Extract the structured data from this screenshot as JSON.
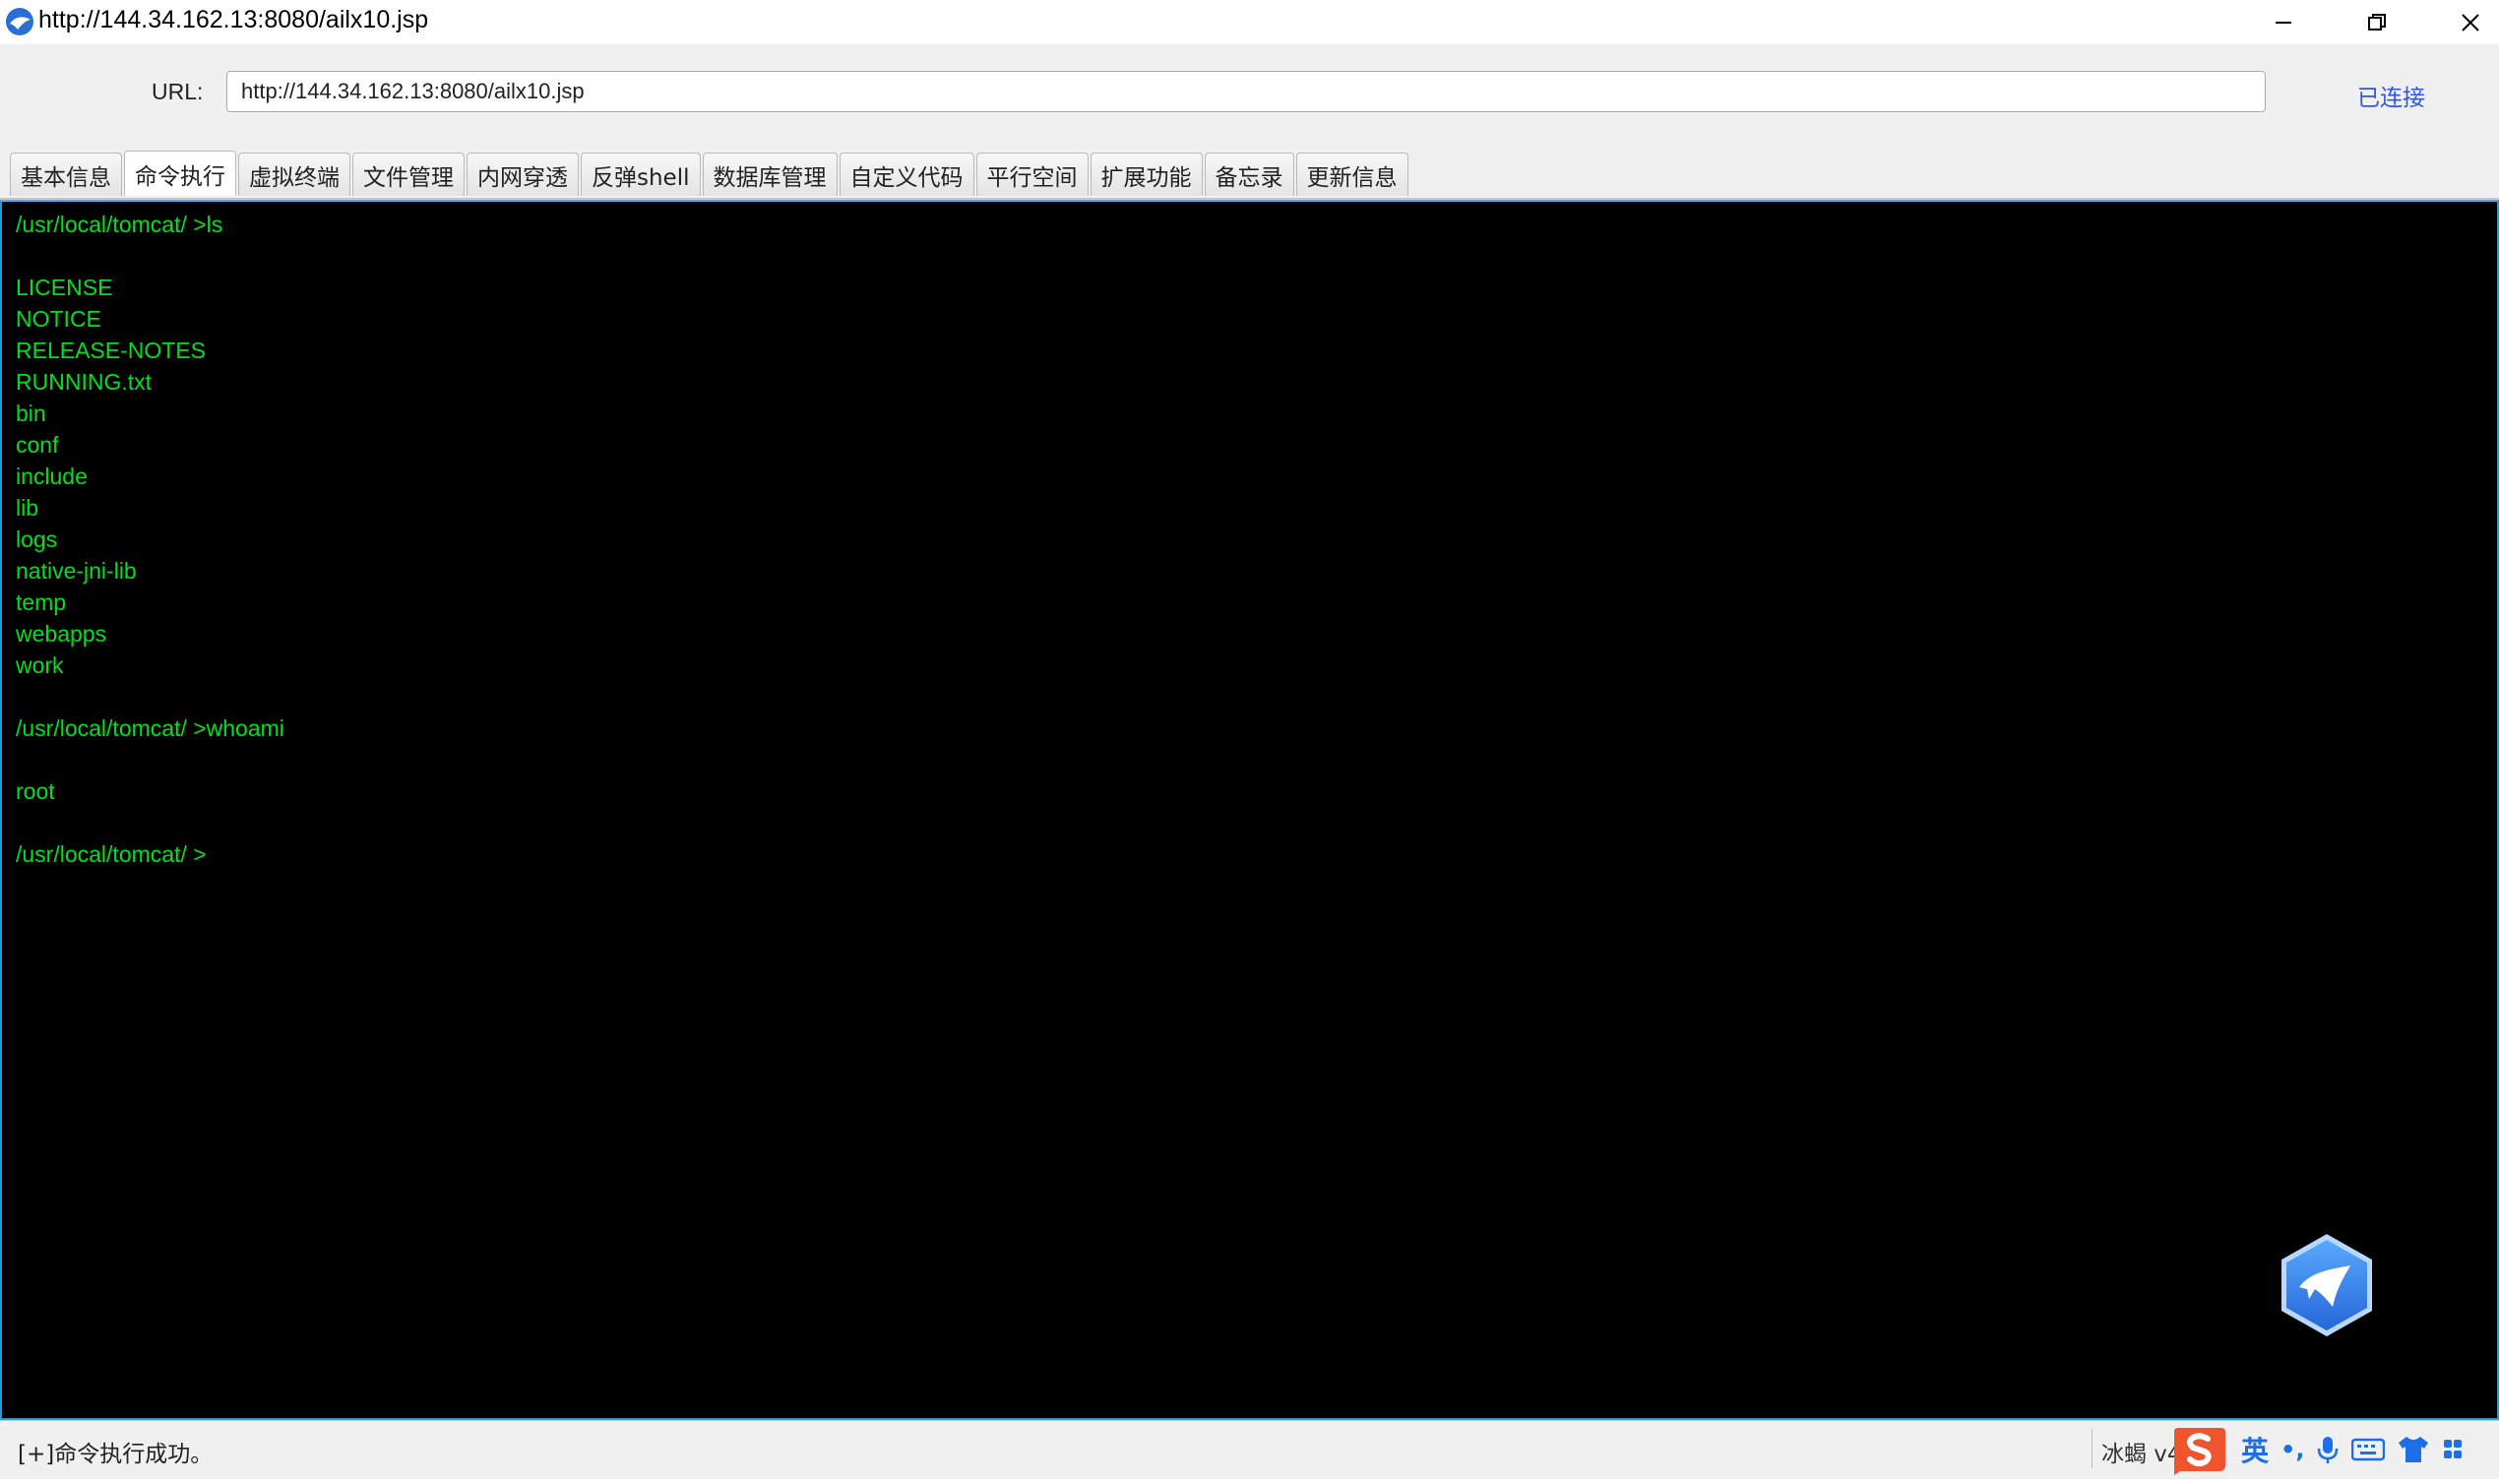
{
  "window": {
    "title": "http://144.34.162.13:8080/ailx10.jsp"
  },
  "urlbar": {
    "label": "URL:",
    "value": "http://144.34.162.13:8080/ailx10.jsp",
    "status": "已连接"
  },
  "tabs": [
    {
      "label": "基本信息",
      "active": false
    },
    {
      "label": "命令执行",
      "active": true
    },
    {
      "label": "虚拟终端",
      "active": false
    },
    {
      "label": "文件管理",
      "active": false
    },
    {
      "label": "内网穿透",
      "active": false
    },
    {
      "label": "反弹shell",
      "active": false
    },
    {
      "label": "数据库管理",
      "active": false
    },
    {
      "label": "自定义代码",
      "active": false
    },
    {
      "label": "平行空间",
      "active": false
    },
    {
      "label": "扩展功能",
      "active": false
    },
    {
      "label": "备忘录",
      "active": false
    },
    {
      "label": "更新信息",
      "active": false
    }
  ],
  "terminal": {
    "lines": [
      "/usr/local/tomcat/ >ls",
      "",
      "LICENSE",
      "NOTICE",
      "RELEASE-NOTES",
      "RUNNING.txt",
      "bin",
      "conf",
      "include",
      "lib",
      "logs",
      "native-jni-lib",
      "temp",
      "webapps",
      "work",
      "",
      "/usr/local/tomcat/ >whoami",
      "",
      "root",
      "",
      "/usr/local/tomcat/ >"
    ],
    "text_color": "#00e020",
    "background": "#000000"
  },
  "statusbar": {
    "message": "[+]命令执行成功。",
    "app_version": "冰蝎 v4",
    "ime_language": "英",
    "ime_punct": "•,"
  },
  "colors": {
    "accent": "#2f54eb",
    "terminal_border": "#1aa0e0"
  }
}
